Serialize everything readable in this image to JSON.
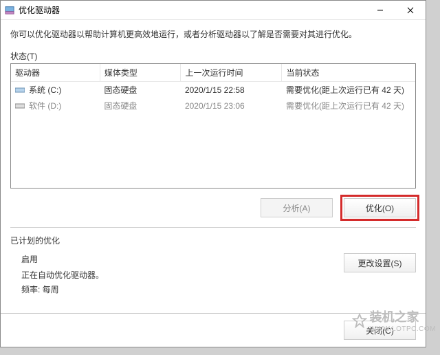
{
  "window": {
    "title": "优化驱动器"
  },
  "desc": "你可以优化驱动器以帮助计算机更高效地运行，或者分析驱动器以了解是否需要对其进行优化。",
  "section_label": "状态(T)",
  "table": {
    "headers": {
      "drive": "驱动器",
      "media": "媒体类型",
      "last": "上一次运行时间",
      "state": "当前状态"
    },
    "rows": [
      {
        "name": "系统 (C:)",
        "media": "固态硬盘",
        "last": "2020/1/15 22:58",
        "state": "需要优化(距上次运行已有 42 天)"
      },
      {
        "name": "软件 (D:)",
        "media": "固态硬盘",
        "last": "2020/1/15 23:06",
        "state": "需要优化(距上次运行已有 42 天)"
      }
    ]
  },
  "buttons": {
    "analyze": "分析(A)",
    "optimize": "优化(O)",
    "change": "更改设置(S)",
    "close": "关闭(C)"
  },
  "schedule": {
    "title": "已计划的优化",
    "enable": "启用",
    "detail": "正在自动优化驱动器。",
    "freq": "频率: 每周"
  },
  "watermark": {
    "bg": "装机之家",
    "small_main": "装机之家",
    "url": "WWW.LOTPC.COM"
  }
}
